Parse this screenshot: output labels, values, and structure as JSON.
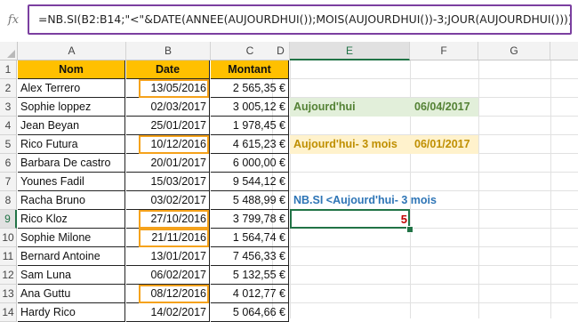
{
  "formula_bar": {
    "fx_label": "fx",
    "formula": "=NB.SI(B2:B14;\"<\"&DATE(ANNEE(AUJOURDHUI());MOIS(AUJOURDHUI())-3;JOUR(AUJOURDHUI())))"
  },
  "columns": [
    "A",
    "B",
    "C",
    "D",
    "E",
    "F",
    "G"
  ],
  "rows": [
    "1",
    "2",
    "3",
    "4",
    "5",
    "6",
    "7",
    "8",
    "9",
    "10",
    "11",
    "12",
    "13",
    "14"
  ],
  "selected_column": "E",
  "selected_row": "9",
  "table": {
    "headers": {
      "nom": "Nom",
      "date": "Date",
      "montant": "Montant"
    },
    "rows": [
      {
        "nom": "Alex Terrero",
        "date": "13/05/2016",
        "montant": "2 565,35 €",
        "highlight": true
      },
      {
        "nom": "Sophie loppez",
        "date": "02/03/2017",
        "montant": "3 005,12 €",
        "highlight": false
      },
      {
        "nom": "Jean Beyan",
        "date": "25/01/2017",
        "montant": "1 978,45 €",
        "highlight": false
      },
      {
        "nom": "Rico Futura",
        "date": "10/12/2016",
        "montant": "4 615,23 €",
        "highlight": true
      },
      {
        "nom": "Barbara De castro",
        "date": "20/01/2017",
        "montant": "6 000,00 €",
        "highlight": false
      },
      {
        "nom": "Younes Fadil",
        "date": "15/03/2017",
        "montant": "9 544,12 €",
        "highlight": false
      },
      {
        "nom": "Racha Bruno",
        "date": "03/02/2017",
        "montant": "5 488,99 €",
        "highlight": false
      },
      {
        "nom": "Rico Kloz",
        "date": "27/10/2016",
        "montant": "3 799,78 €",
        "highlight": true
      },
      {
        "nom": "Sophie Milone",
        "date": "21/11/2016",
        "montant": "1 564,74 €",
        "highlight": true
      },
      {
        "nom": "Bernard Antoine",
        "date": "13/01/2017",
        "montant": "7 456,33 €",
        "highlight": false
      },
      {
        "nom": "Sam Luna",
        "date": "06/02/2017",
        "montant": "5 132,55 €",
        "highlight": false
      },
      {
        "nom": "Ana Guttu",
        "date": "08/12/2016",
        "montant": "4 012,77 €",
        "highlight": true
      },
      {
        "nom": "Hardy Rico",
        "date": "14/02/2017",
        "montant": "5 064,66 €",
        "highlight": false
      }
    ]
  },
  "side": {
    "today_label": "Aujourd'hui",
    "today_value": "06/04/2017",
    "minus3_label": "Aujourd'hui- 3 mois",
    "minus3_value": "06/01/2017",
    "count_label": "NB.SI <Aujourd'hui- 3 mois",
    "count_value": "5"
  },
  "colors": {
    "header_fill": "#ffc000",
    "highlight_border": "#f5a21b",
    "green_text": "#548235",
    "orange_text": "#bf8f00",
    "blue_text": "#2e75b6",
    "result_text": "#c00000",
    "selection": "#217346",
    "formula_border": "#7b3fa0"
  }
}
